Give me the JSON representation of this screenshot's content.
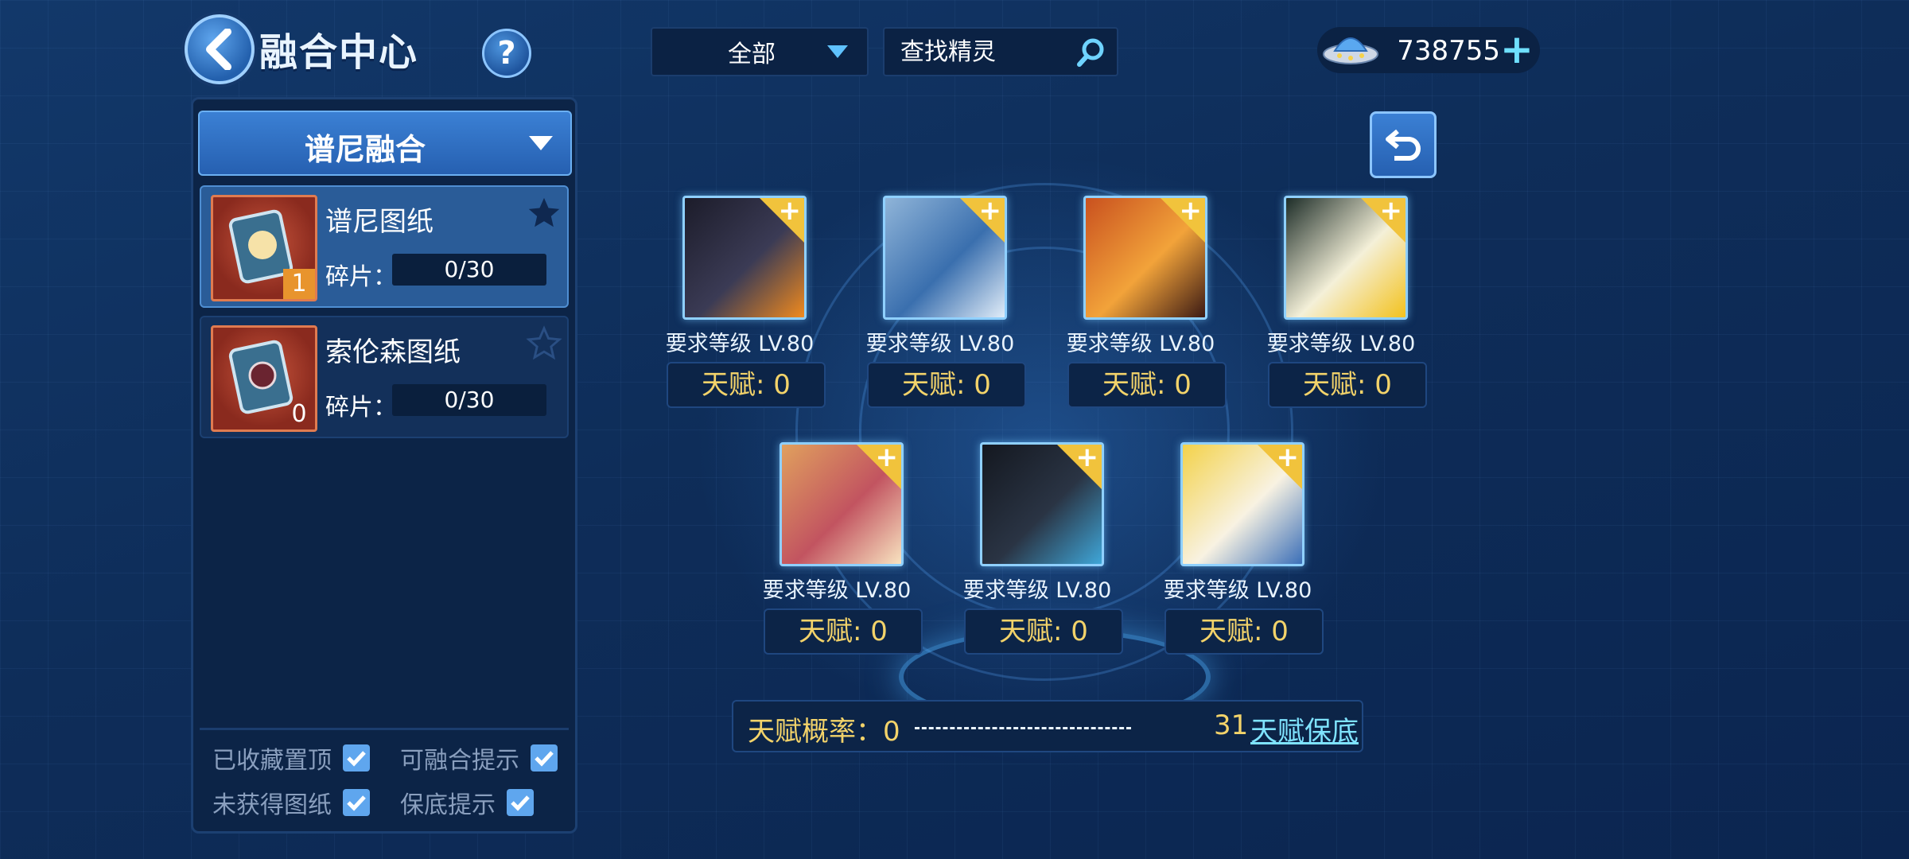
{
  "header": {
    "title": "融合中心",
    "help_label": "?",
    "filter": {
      "selected": "全部"
    },
    "search": {
      "placeholder": "查找精灵"
    },
    "currency": {
      "amount": "738755"
    }
  },
  "left_panel": {
    "group_select": "谱尼融合",
    "blueprints": [
      {
        "name": "谱尼图纸",
        "count": "1",
        "fragments_label": "碎片：",
        "fragments": "0/30",
        "favorited": true,
        "selected": true
      },
      {
        "name": "索伦森图纸",
        "count": "0",
        "fragments_label": "碎片：",
        "fragments": "0/30",
        "favorited": false,
        "selected": false
      }
    ],
    "options": [
      {
        "label": "已收藏置顶",
        "checked": true
      },
      {
        "label": "可融合提示",
        "checked": true
      },
      {
        "label": "未获得图纸",
        "checked": true
      },
      {
        "label": "保底提示",
        "checked": true
      }
    ]
  },
  "slots": [
    {
      "requirement": "要求等级 LV.80",
      "talent": "天赋: 0",
      "colors": [
        "#1c1c2a",
        "#3b3b55",
        "#f08a1e"
      ]
    },
    {
      "requirement": "要求等级 LV.80",
      "talent": "天赋: 0",
      "colors": [
        "#8fb4d8",
        "#3a6fae",
        "#e0ecf8"
      ]
    },
    {
      "requirement": "要求等级 LV.80",
      "talent": "天赋: 0",
      "colors": [
        "#c9511f",
        "#f2a33a",
        "#3b1a14"
      ]
    },
    {
      "requirement": "要求等级 LV.80",
      "talent": "天赋: 0",
      "colors": [
        "#1d2d28",
        "#f4f0d8",
        "#f3c21e"
      ]
    },
    {
      "requirement": "要求等级 LV.80",
      "talent": "天赋: 0",
      "colors": [
        "#e0a05e",
        "#c25460",
        "#f8e3c0"
      ]
    },
    {
      "requirement": "要求等级 LV.80",
      "talent": "天赋: 0",
      "colors": [
        "#141820",
        "#2a3444",
        "#3fa6d8"
      ]
    },
    {
      "requirement": "要求等级 LV.80",
      "talent": "天赋: 0",
      "colors": [
        "#f3d24a",
        "#f8f2e2",
        "#3b6fb8"
      ]
    }
  ],
  "talent_bar": {
    "label": "天赋概率：0",
    "value": "31",
    "link": "天赋保底"
  },
  "colors": {
    "accent": "#5fa6ee",
    "talent_text": "#f3d36a",
    "slot_corner": "#f1c33c"
  }
}
